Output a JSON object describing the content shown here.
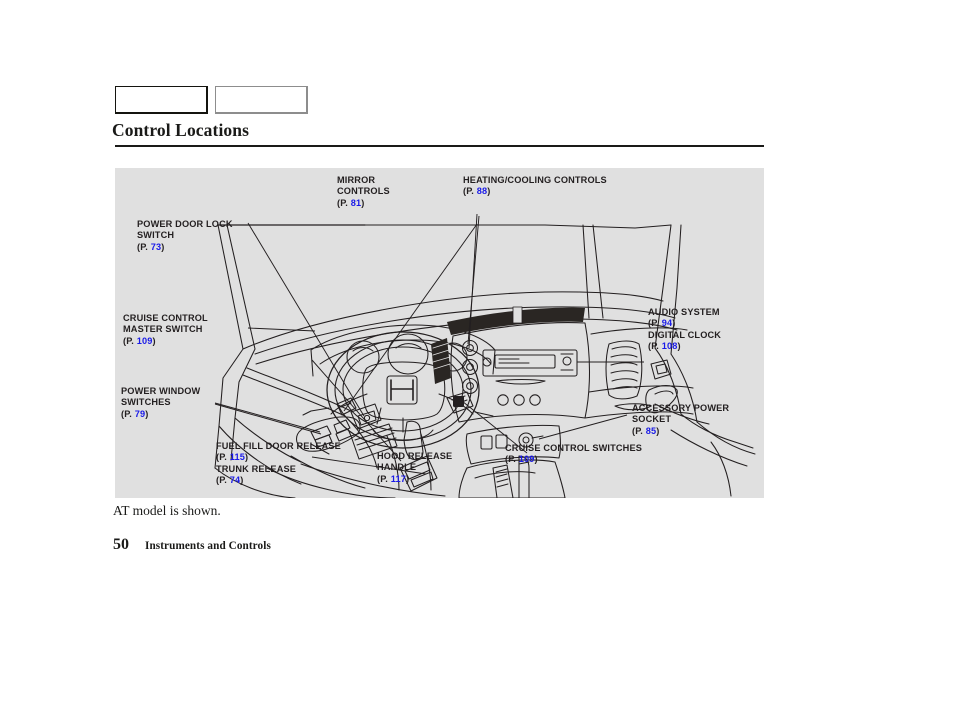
{
  "header": {
    "tabs": [
      "",
      ""
    ],
    "section_title": "Control Locations"
  },
  "figure": {
    "background_color": "#e0e0e0",
    "page_ref_color": "#1a1ae8",
    "illustration_name": "instrument-panel-line-art",
    "callouts": [
      {
        "id": "mirror-controls",
        "lines": [
          "MIRROR",
          "CONTROLS"
        ],
        "page_prefix": "(P. ",
        "page": "81",
        "page_suffix": ")"
      },
      {
        "id": "heating-cooling",
        "lines": [
          "HEATING/COOLING CONTROLS"
        ],
        "page_prefix": "(P. ",
        "page": "88",
        "page_suffix": ")"
      },
      {
        "id": "power-door-lock",
        "lines": [
          "POWER DOOR LOCK",
          "SWITCH"
        ],
        "page_prefix": "(P. ",
        "page": "73",
        "page_suffix": ")"
      },
      {
        "id": "cruise-master-switch",
        "lines": [
          "CRUISE CONTROL",
          "MASTER SWITCH"
        ],
        "page_prefix": "(P. ",
        "page": "109",
        "page_suffix": ")"
      },
      {
        "id": "power-window-switches",
        "lines": [
          "POWER WINDOW",
          "SWITCHES"
        ],
        "page_prefix": "(P. ",
        "page": "79",
        "page_suffix": ")"
      },
      {
        "id": "audio-system",
        "lines": [
          "AUDIO SYSTEM"
        ],
        "page_prefix": "(P. ",
        "page": "94",
        "page_suffix": ")"
      },
      {
        "id": "digital-clock",
        "lines": [
          "DIGITAL CLOCK"
        ],
        "page_prefix": "(P. ",
        "page": "108",
        "page_suffix": ")"
      },
      {
        "id": "accessory-power-socket",
        "lines": [
          "ACCESSORY POWER",
          "SOCKET"
        ],
        "page_prefix": "(P. ",
        "page": "85",
        "page_suffix": ")"
      },
      {
        "id": "fuel-fill-door-release",
        "lines": [
          "FUEL FILL DOOR RELEASE"
        ],
        "page_prefix": "(P. ",
        "page": "115",
        "page_suffix": ")"
      },
      {
        "id": "trunk-release",
        "lines": [
          "TRUNK RELEASE"
        ],
        "page_prefix": "(P. ",
        "page": "74",
        "page_suffix": ")"
      },
      {
        "id": "hood-release-handle",
        "lines": [
          "HOOD RELEASE",
          "HANDLE"
        ],
        "page_prefix": "(P. ",
        "page": "117",
        "page_suffix": ")"
      },
      {
        "id": "cruise-control-switches",
        "lines": [
          "CRUISE CONTROL SWITCHES"
        ],
        "page_prefix": "(P. ",
        "page": "109",
        "page_suffix": ")"
      }
    ]
  },
  "caption": "AT model is shown.",
  "footer": {
    "page_number": "50",
    "chapter": "Instruments and Controls"
  }
}
